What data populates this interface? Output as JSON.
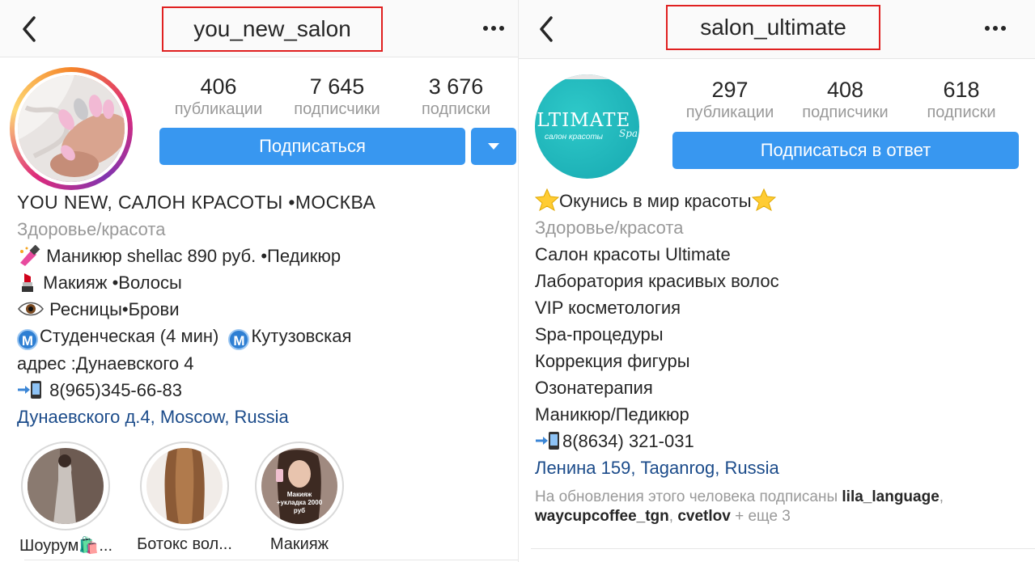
{
  "left": {
    "username": "you_new_salon",
    "stats": [
      {
        "value": "406",
        "label": "публикации"
      },
      {
        "value": "7 645",
        "label": "подписчики"
      },
      {
        "value": "3 676",
        "label": "подписки"
      }
    ],
    "follow_button": "Подписаться",
    "bio": {
      "title": "YOU NEW, САЛОН КРАСОТЫ •МОСКВА",
      "category": "Здоровье/красота",
      "line1": "Маникюр shellac 890 руб. •Педикюр",
      "line2": "Макияж •Волосы",
      "line3": "Ресницы•Брови",
      "metro_badge": "M",
      "metro1": "Студенческая (4 мин)",
      "metro2": "Кутузовская",
      "address": "адрес :Дунаевского 4",
      "phone": "8(965)345-66-83",
      "location": "Дунаевского д.4, Moscow, Russia"
    },
    "highlights": [
      {
        "label": "Шоурум🛍️..."
      },
      {
        "label": "Ботокс вол..."
      },
      {
        "label": "Макияж",
        "image_text": [
          "Макияж",
          "+укладка 2000",
          "руб"
        ]
      }
    ]
  },
  "right": {
    "username": "salon_ultimate",
    "avatar_text": "ULTIMATE",
    "avatar_subtext": "салон красоты",
    "avatar_script": "Spa",
    "stats": [
      {
        "value": "297",
        "label": "публикации"
      },
      {
        "value": "408",
        "label": "подписчики"
      },
      {
        "value": "618",
        "label": "подписки"
      }
    ],
    "follow_button": "Подписаться в ответ",
    "bio": {
      "title": "Окунись в мир красоты",
      "category": "Здоровье/красота",
      "lines": [
        "Салон красоты Ultimate",
        "Лаборатория красивых волос",
        "VIP косметология",
        "Spa-процедуры",
        "Коррекция фигуры",
        "Озонатерапия",
        "Маникюр/Педикюр"
      ],
      "phone": "8(8634) 321-031",
      "location": "Ленина 159, Taganrog, Russia"
    },
    "followed_by": {
      "prefix": "На обновления этого человека подписаны",
      "user1": "lila_language",
      "user2": "waycupcoffee_tgn",
      "user3": "cvetlov",
      "suffix": "+ еще 3"
    }
  },
  "colors": {
    "accent": "#3897f0",
    "link": "#1b4b8a",
    "highlight_box": "#e02020",
    "muted": "#999999"
  },
  "icons": [
    "back-chevron-icon",
    "more-dots-icon",
    "dropdown-triangle-icon",
    "nail-polish-icon",
    "lipstick-icon",
    "eye-icon",
    "metro-icon",
    "phone-arrow-icon",
    "star-icon"
  ]
}
